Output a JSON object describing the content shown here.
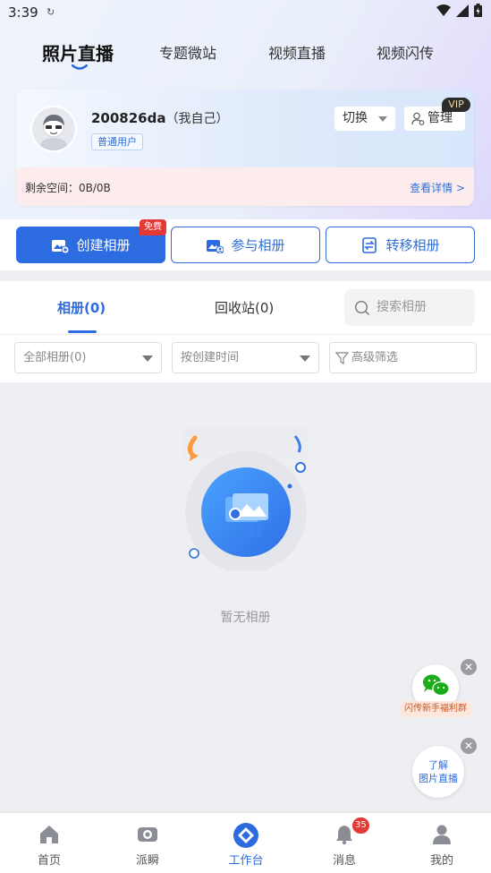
{
  "status_bar": {
    "time": "3:39"
  },
  "main_tabs": [
    {
      "label": "照片直播",
      "active": true
    },
    {
      "label": "专题微站",
      "active": false
    },
    {
      "label": "视频直播",
      "active": false
    },
    {
      "label": "视频闪传",
      "active": false
    }
  ],
  "account": {
    "username": "200826da",
    "username_note": "（我自己）",
    "user_type": "普通用户",
    "switch_label": "切换",
    "manage_label": "管理",
    "vip_label": "VIP",
    "space_label": "剩余空间：0B/0B",
    "detail_link": "查看详情 >"
  },
  "actions": {
    "create_album": "创建相册",
    "free_badge": "免费",
    "join_album": "参与相册",
    "transfer_album": "转移相册"
  },
  "list_tabs": {
    "albums": "相册(0)",
    "recycle_bin": "回收站(0)",
    "search_placeholder": "搜索相册"
  },
  "filters": {
    "all_albums": "全部相册(0)",
    "sort_by": "按创建时间",
    "advanced": "高级筛选"
  },
  "empty_state": {
    "text": "暂无相册"
  },
  "floating": {
    "wechat_label": "闪传新手福利群",
    "learn_line1": "了解",
    "learn_line2": "图片直播"
  },
  "bottom_nav": [
    {
      "label": "首页",
      "icon": "home-icon",
      "active": false
    },
    {
      "label": "派瞬",
      "icon": "camera-icon",
      "active": false
    },
    {
      "label": "工作台",
      "icon": "workbench-icon",
      "active": true
    },
    {
      "label": "消息",
      "icon": "bell-icon",
      "active": false,
      "badge": "35"
    },
    {
      "label": "我的",
      "icon": "person-icon",
      "active": false
    }
  ],
  "colors": {
    "accent": "#2c6ce0",
    "badge_red": "#e53935",
    "vip_bg": "#2b2b2b"
  }
}
